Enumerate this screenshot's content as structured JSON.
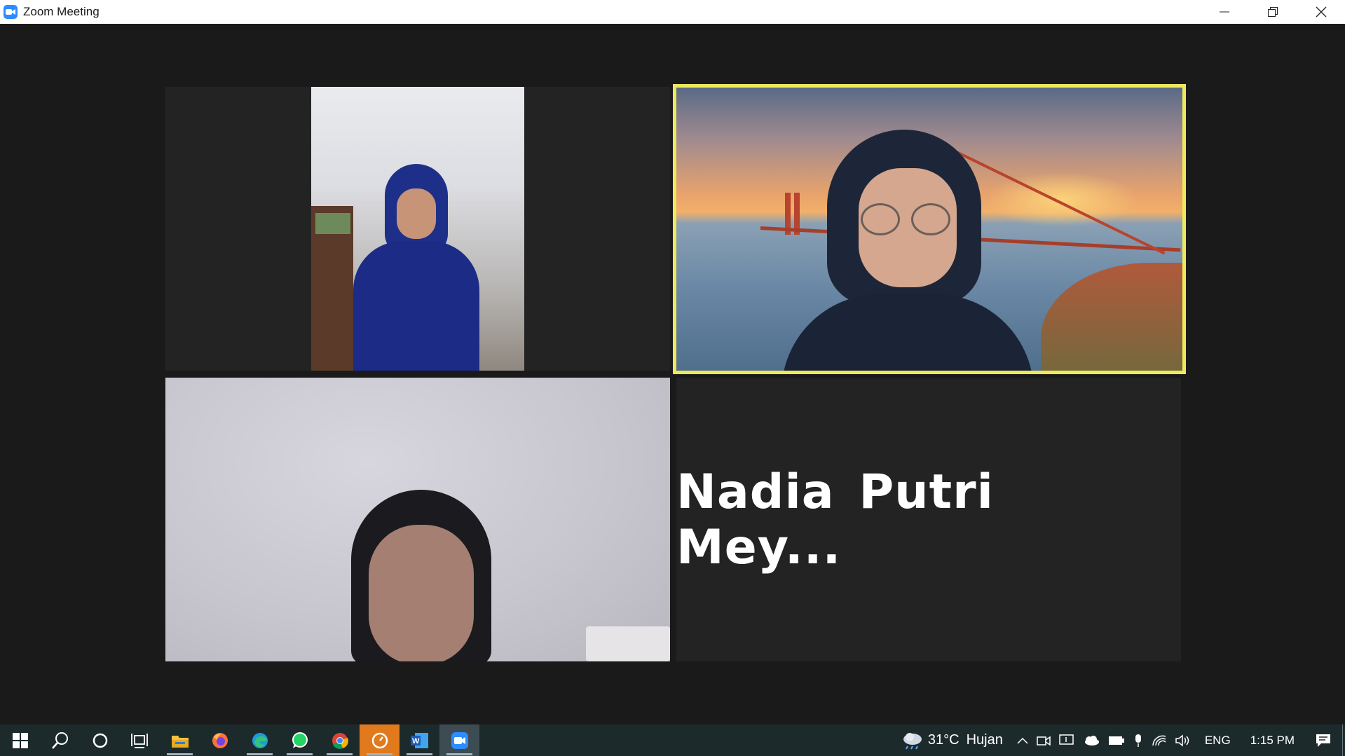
{
  "window": {
    "title": "Zoom Meeting"
  },
  "participants": {
    "name_tile_label": "Nadia Putri Mey..."
  },
  "taskbar": {
    "pinned": [
      "windows-start",
      "search",
      "cortana",
      "task-view",
      "file-explorer",
      "firefox",
      "edge",
      "whatsapp",
      "chrome",
      "clock-app",
      "word",
      "zoom"
    ],
    "weather": {
      "temperature": "31°C",
      "condition": "Hujan"
    },
    "language": "ENG",
    "time": "1:15 PM"
  },
  "colors": {
    "active_speaker_border": "#ede95b",
    "taskbar_bg": "#1d2a2c",
    "zoom_blue": "#2d8cff"
  }
}
